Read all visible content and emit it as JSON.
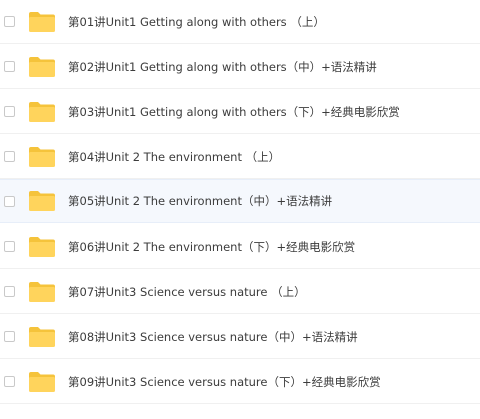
{
  "files": [
    {
      "name": "第01讲Unit1 Getting along with others （上）"
    },
    {
      "name": "第02讲Unit1 Getting along with others（中）+语法精讲"
    },
    {
      "name": "第03讲Unit1 Getting along with others（下）+经典电影欣赏"
    },
    {
      "name": "第04讲Unit 2 The environment （上）"
    },
    {
      "name": "第05讲Unit 2 The environment（中）+语法精讲"
    },
    {
      "name": "第06讲Unit 2 The environment（下）+经典电影欣赏"
    },
    {
      "name": "第07讲Unit3 Science versus nature （上）"
    },
    {
      "name": "第08讲Unit3 Science versus nature（中）+语法精讲"
    },
    {
      "name": "第09讲Unit3 Science versus nature（下）+经典电影欣赏"
    }
  ],
  "icons": {
    "folder": "folder-icon",
    "checkbox": "checkbox"
  },
  "colors": {
    "folder_body": "#FFD45C",
    "folder_tab": "#F5C33B",
    "hover_row": "#F5F8FD"
  }
}
